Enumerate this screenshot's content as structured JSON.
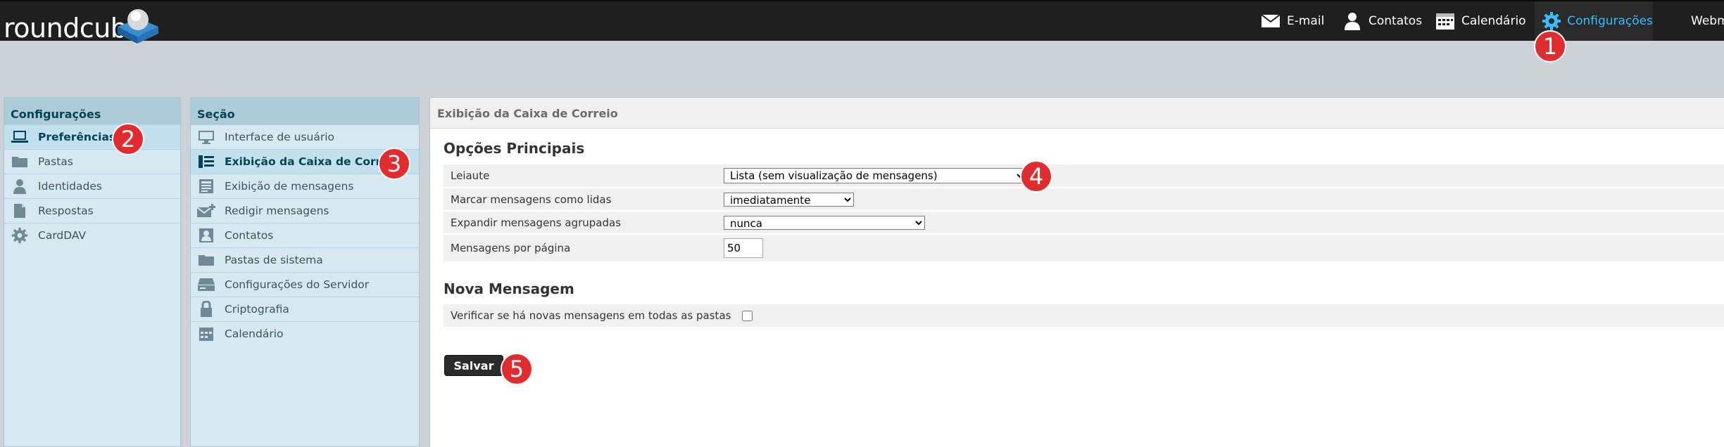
{
  "app": {
    "logo_text": "roundcube"
  },
  "topnav": {
    "email": "E-mail",
    "contacts": "Contatos",
    "calendar": "Calendário",
    "settings": "Configurações",
    "webmail": "Webm"
  },
  "badges": [
    "1",
    "2",
    "3",
    "4",
    "5"
  ],
  "settings_panel": {
    "title": "Configurações",
    "items": [
      {
        "label": "Preferências",
        "icon": "laptop-icon"
      },
      {
        "label": "Pastas",
        "icon": "folder-icon"
      },
      {
        "label": "Identidades",
        "icon": "user-icon"
      },
      {
        "label": "Respostas",
        "icon": "document-icon"
      },
      {
        "label": "CardDAV",
        "icon": "gear-icon"
      }
    ]
  },
  "section_panel": {
    "title": "Seção",
    "items": [
      {
        "label": "Interface de usuário",
        "icon": "monitor-icon"
      },
      {
        "label": "Exibição da Caixa de Correio",
        "icon": "mailbox-list-icon"
      },
      {
        "label": "Exibição de mensagens",
        "icon": "message-view-icon"
      },
      {
        "label": "Redigir mensagens",
        "icon": "compose-icon"
      },
      {
        "label": "Contatos",
        "icon": "contact-card-icon"
      },
      {
        "label": "Pastas de sistema",
        "icon": "folder-icon"
      },
      {
        "label": "Configurações do Servidor",
        "icon": "server-icon"
      },
      {
        "label": "Criptografia",
        "icon": "lock-icon"
      },
      {
        "label": "Calendário",
        "icon": "calendar-icon"
      }
    ]
  },
  "main": {
    "header": "Exibição da Caixa de Correio",
    "main_options_title": "Opções Principais",
    "layout_label": "Leiaute",
    "layout_value": "Lista (sem visualização de mensagens)",
    "mark_read_label": "Marcar mensagens como lidas",
    "mark_read_value": "imediatamente",
    "expand_threads_label": "Expandir mensagens agrupadas",
    "expand_threads_value": "nunca",
    "per_page_label": "Mensagens por página",
    "per_page_value": "50",
    "new_message_title": "Nova Mensagem",
    "check_all_label": "Verificar se há novas mensagens em todas as pastas",
    "check_all_checked": false,
    "save_label": "Salvar"
  },
  "colors": {
    "topbar": "#1f1f1f",
    "accent": "#37beff",
    "badge": "#e02b2f",
    "panel": "#d7e8f0"
  }
}
